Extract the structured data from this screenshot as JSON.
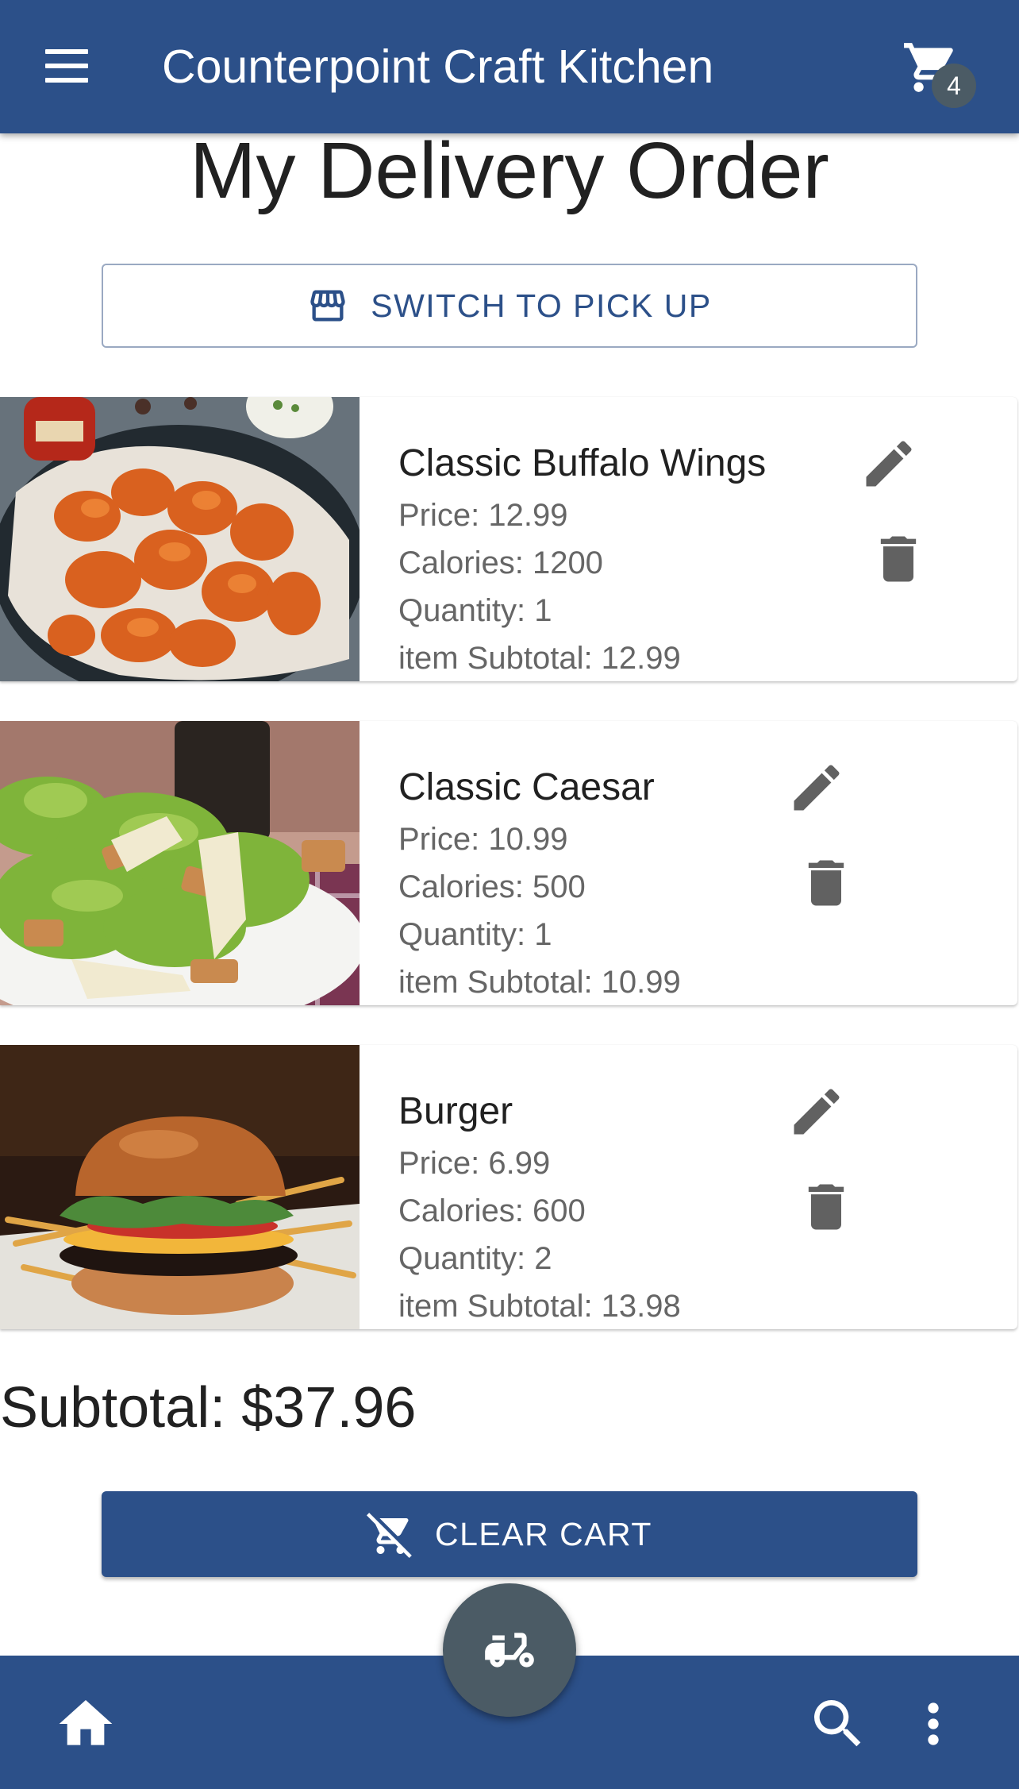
{
  "app": {
    "title": "Counterpoint Craft Kitchen",
    "cart_count": "4",
    "colors": {
      "primary": "#2c5089",
      "fab": "#4b5b65",
      "text_secondary": "#666666"
    }
  },
  "page": {
    "title": "My Delivery Order",
    "switch_button_label": "SWITCH TO PICK UP",
    "switch_button_icon": "store-icon"
  },
  "items": [
    {
      "name": "Classic Buffalo Wings",
      "price": "Price: 12.99",
      "calories": "Calories: 1200",
      "quantity": "Quantity: 1",
      "subtotal": "item Subtotal: 12.99"
    },
    {
      "name": "Classic Caesar",
      "price": "Price: 10.99",
      "calories": "Calories: 500",
      "quantity": "Quantity: 1",
      "subtotal": "item Subtotal: 10.99"
    },
    {
      "name": "Burger",
      "price": "Price: 6.99",
      "calories": "Calories: 600",
      "quantity": "Quantity: 2",
      "subtotal": "item Subtotal: 13.98"
    }
  ],
  "summary": {
    "subtotal": "Subtotal: $37.96",
    "clear_button_label": "CLEAR CART",
    "clear_button_icon": "remove-shopping-cart-icon"
  },
  "bottom_nav": {
    "left": "home-icon",
    "center": "delivery-scooter-icon",
    "right": [
      "search-icon",
      "more-vert-icon"
    ]
  }
}
